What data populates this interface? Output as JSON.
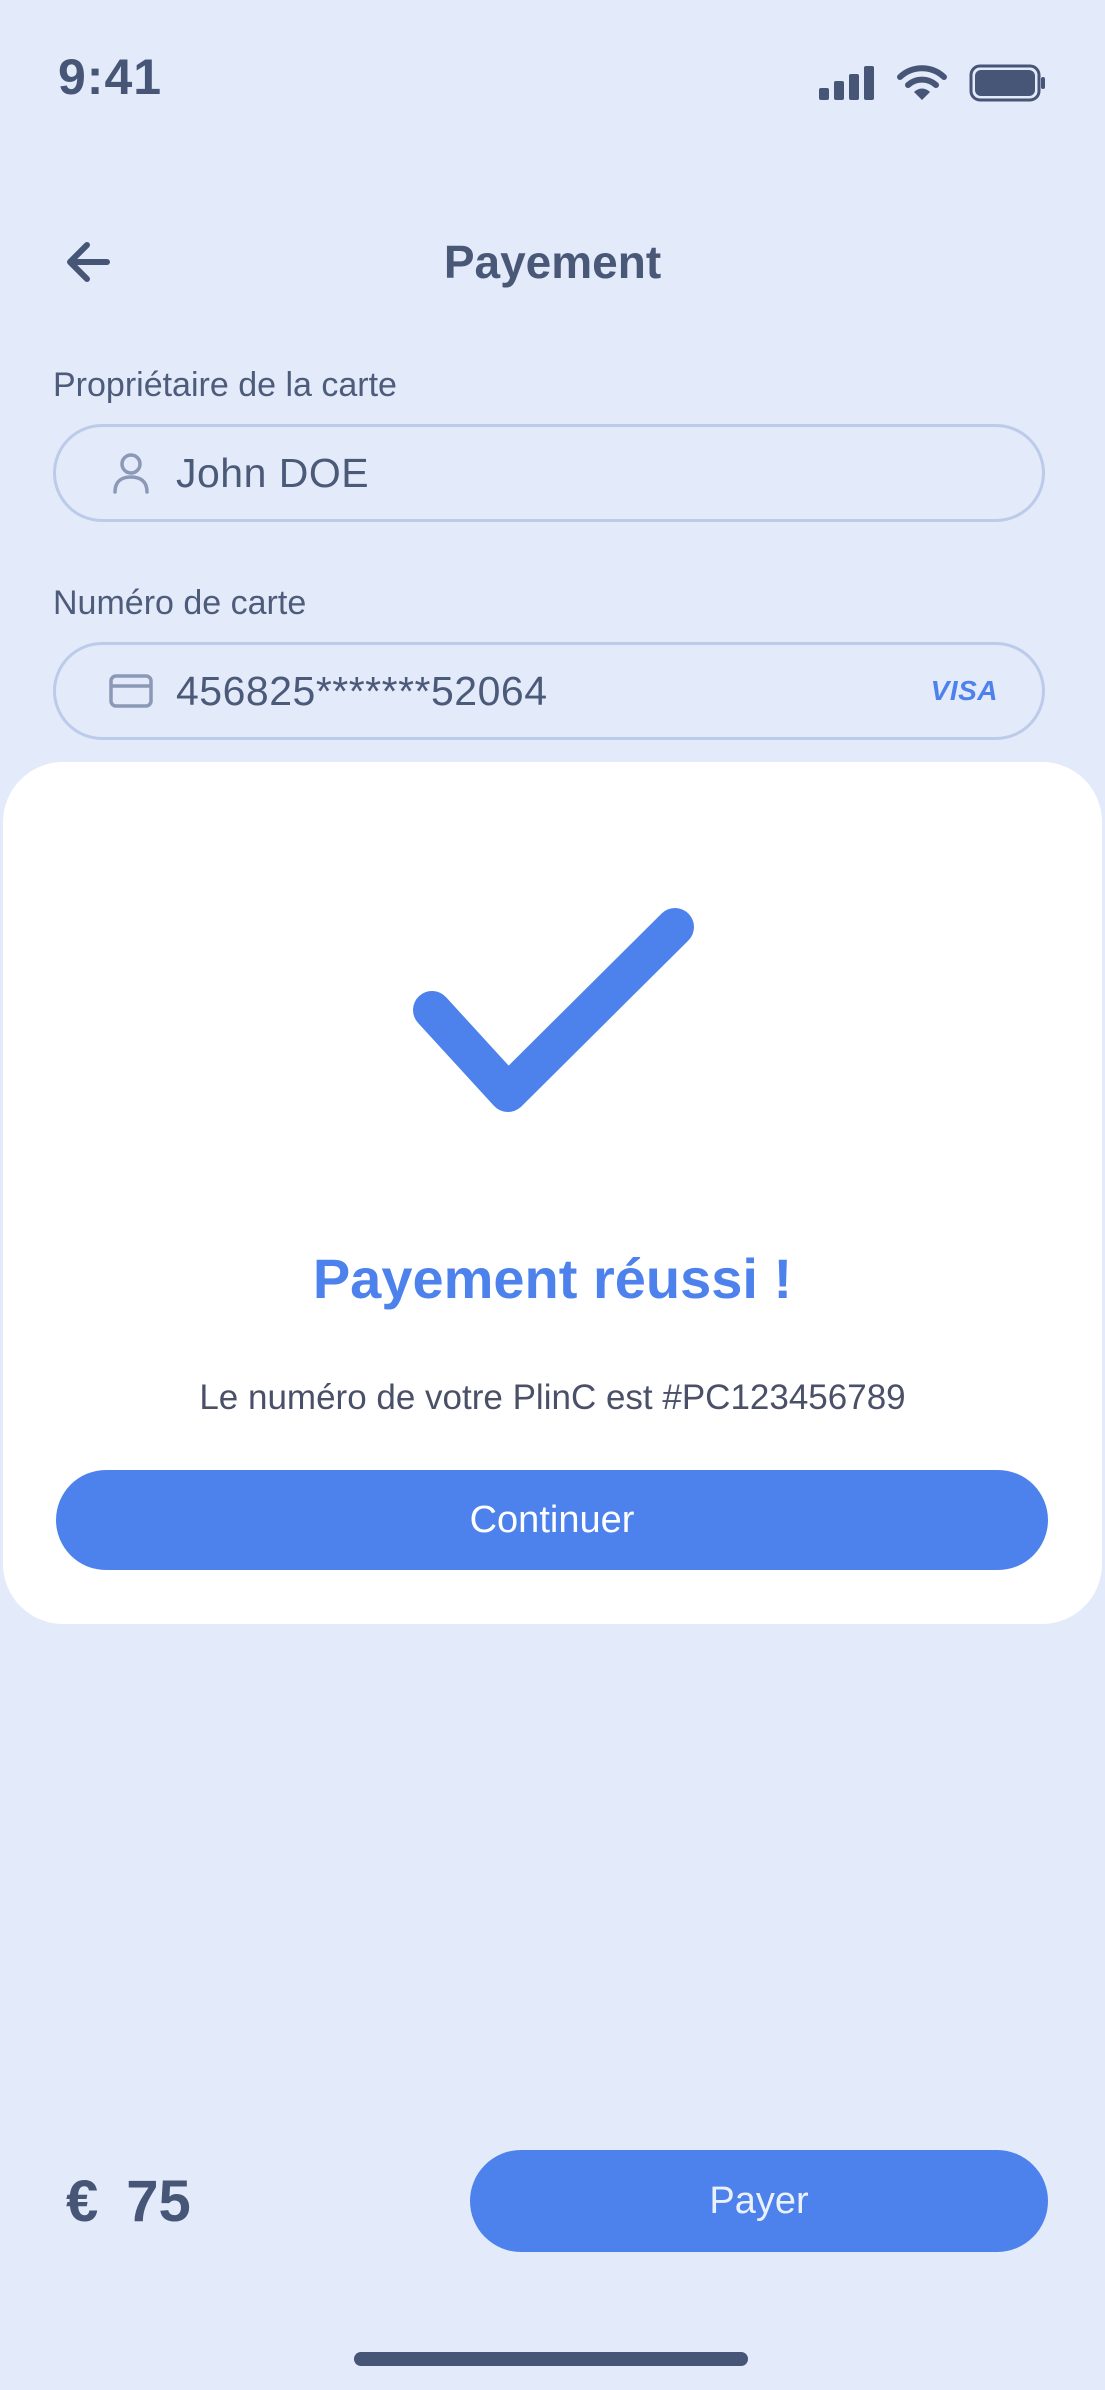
{
  "status_bar": {
    "time": "9:41"
  },
  "header": {
    "title": "Payement"
  },
  "form": {
    "owner": {
      "label": "Propriétaire de la carte",
      "value": "John DOE"
    },
    "card": {
      "label": "Numéro de carte",
      "value": "456825*******52064",
      "brand": "VISA"
    }
  },
  "success": {
    "title": "Payement réussi !",
    "message": "Le numéro de votre PlinC est #PC123456789",
    "continue_label": "Continuer"
  },
  "footer": {
    "currency": "€",
    "amount": "75",
    "pay_label": "Payer"
  },
  "colors": {
    "background": "#e3eaf9",
    "accent": "#4d82ec",
    "text": "#475676",
    "sheet": "#ffffff"
  },
  "icons": [
    "back-arrow-icon",
    "user-icon",
    "credit-card-icon",
    "checkmark-icon",
    "signal-icon",
    "wifi-icon",
    "battery-icon"
  ]
}
